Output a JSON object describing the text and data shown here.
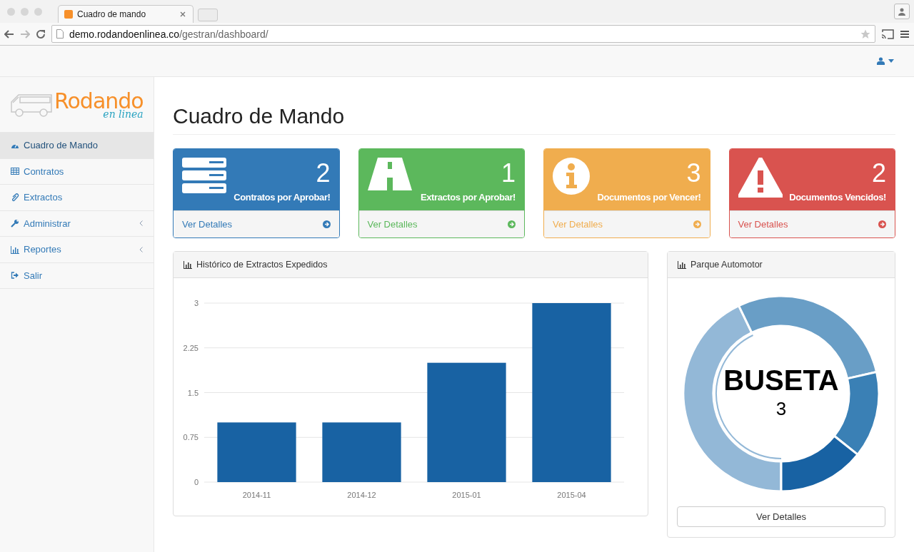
{
  "browser": {
    "tab_title": "Cuadro de mando",
    "url_host": "demo.rodandoenlinea.co",
    "url_path": "/gestran/dashboard/"
  },
  "logo": {
    "word": "Rodando",
    "tagline": "en linea"
  },
  "sidebar": {
    "items": [
      {
        "label": "Cuadro de Mando",
        "selected": true,
        "expandable": false
      },
      {
        "label": "Contratos",
        "selected": false,
        "expandable": false
      },
      {
        "label": "Extractos",
        "selected": false,
        "expandable": false
      },
      {
        "label": "Administrar",
        "selected": false,
        "expandable": true
      },
      {
        "label": "Reportes",
        "selected": false,
        "expandable": true
      },
      {
        "label": "Salir",
        "selected": false,
        "expandable": false
      }
    ]
  },
  "page_title": "Cuadro de Mando",
  "cards": [
    {
      "count": "2",
      "label": "Contratos por Aprobar!",
      "link": "Ver Detalles",
      "color": "#337ab7"
    },
    {
      "count": "1",
      "label": "Extractos por Aprobar!",
      "link": "Ver Detalles",
      "color": "#5cb85c"
    },
    {
      "count": "3",
      "label": "Documentos por Vencer!",
      "link": "Ver Detalles",
      "color": "#f0ad4e"
    },
    {
      "count": "2",
      "label": "Documentos Vencidos!",
      "link": "Ver Detalles",
      "color": "#d9534f"
    }
  ],
  "history_panel": {
    "title": "Histórico de Extractos Expedidos",
    "chart_data": {
      "type": "bar",
      "categories": [
        "2014-11",
        "2014-12",
        "2015-01",
        "2015-04"
      ],
      "values": [
        1,
        1,
        2,
        3
      ],
      "grid": true,
      "ylim": [
        0,
        3
      ],
      "yticks": [
        0,
        {
          "value": 0.75,
          "label": "0.75"
        },
        {
          "value": 1.5,
          "label": "1.5"
        },
        {
          "value": 2.25,
          "label": "2.25"
        },
        3
      ]
    }
  },
  "fleet_panel": {
    "title": "Parque Automotor",
    "center_label": "BUSETA",
    "center_value": "3",
    "button": "Ver Detalles"
  }
}
